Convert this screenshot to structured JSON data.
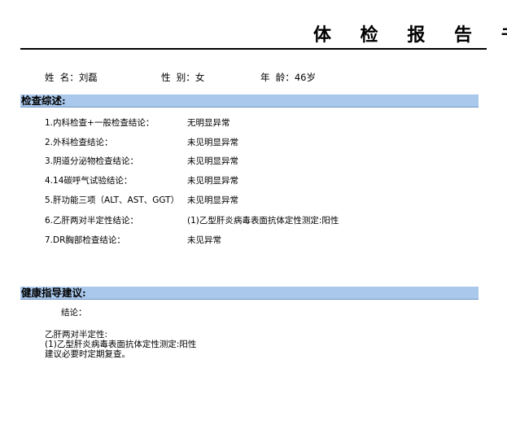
{
  "report": {
    "title": "体 检 报 告 书",
    "patient": {
      "name_label": "姓  名：",
      "name": "刘磊",
      "gender_label": "性  别：",
      "gender": "女",
      "age_label": "年  龄：",
      "age": "46岁"
    },
    "summary": {
      "heading": "检查综述:",
      "items": [
        {
          "label": "1.内科检查+一般检查结论：",
          "value": "无明显异常"
        },
        {
          "label": "2.外科检查结论：",
          "value": "未见明显异常"
        },
        {
          "label": "3.阴道分泌物检查结论：",
          "value": "未见明显异常"
        },
        {
          "label": "4.14碳呼气试验结论：",
          "value": "未见明显异常"
        },
        {
          "label": "5.肝功能三项（ALT、AST、GGT）",
          "value": "未见明显异常"
        },
        {
          "label": "6.乙肝两对半定性结论：",
          "value": "(1)乙型肝炎病毒表面抗体定性测定:阳性"
        },
        {
          "label": "7.DR胸部检查结论：",
          "value": "未见异常"
        }
      ]
    },
    "advice": {
      "heading": "健康指导建议:",
      "conclusion_label": "结论：",
      "lines": [
        "乙肝两对半定性:",
        "(1)乙型肝炎病毒表面抗体定性测定:阳性",
        "建议必要时定期复查。"
      ]
    }
  }
}
